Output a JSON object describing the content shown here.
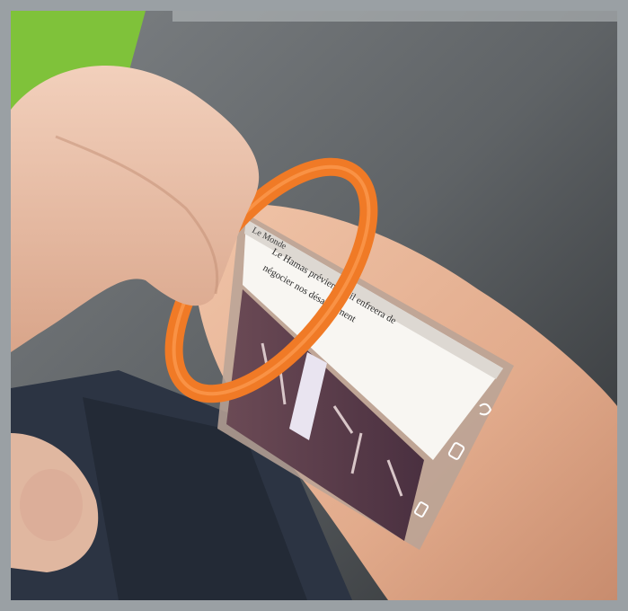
{
  "photo": {
    "projected_screen": {
      "header": "Le Monde",
      "article_lines": [
        "Le Hamas prévient qu'il enfreera de",
        "négocier nos désarmement"
      ],
      "nav_icons": [
        "back-icon",
        "home-icon",
        "recent-apps-icon"
      ]
    },
    "colors": {
      "background": "#6f7376",
      "green_wall": "#7fc23a",
      "bracelet": "#f07a26",
      "skin": "#e7b79a",
      "sleeve": "#2c3443"
    }
  }
}
